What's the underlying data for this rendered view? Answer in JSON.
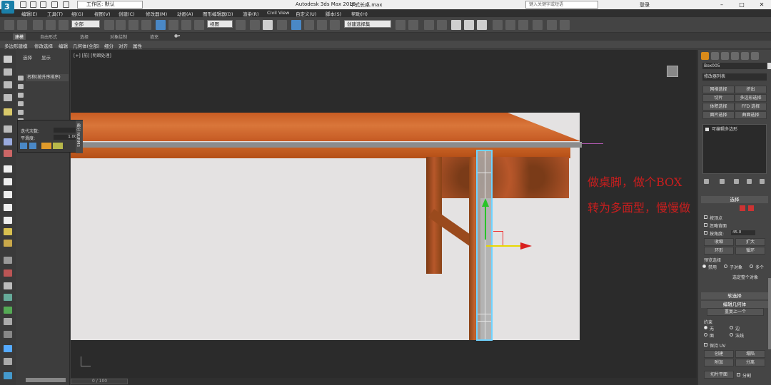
{
  "window": {
    "title": "Autodesk 3ds Max 2016",
    "file_name": "中式长桌.max",
    "workspace_label": "工作区: 默认",
    "search_placeholder": "键入关键字或短语",
    "sign_in": "登录",
    "minimize": "–",
    "maximize": "□",
    "close": "✕"
  },
  "menu": [
    "编辑(E)",
    "工具(T)",
    "组(G)",
    "视图(V)",
    "创建(C)",
    "修改器(M)",
    "动画(A)",
    "图形编辑器(D)",
    "渲染(R)",
    "Civil View",
    "自定义(U)",
    "脚本(S)",
    "帮助(H)"
  ],
  "toolbar": {
    "filter": "全部",
    "coord": "视图",
    "selection_set": "创建选择集"
  },
  "ribbon": {
    "tabs": [
      "建模",
      "自由形式",
      "选择",
      "对象绘制",
      "填充"
    ],
    "active_tab": "建模",
    "sub_items": [
      "多边形建模",
      "修改选择",
      "编辑",
      "几何体(全部)",
      "细分",
      "对齐",
      "属性"
    ]
  },
  "explorer": {
    "tabs": [
      "选择",
      "显示"
    ],
    "header": "名称(按升序排序)"
  },
  "floatpanel": {
    "iter_label": "迭代次数:",
    "iter_value": "1",
    "smooth_label": "平滑度:",
    "smooth_value": "1.000",
    "side_tab": "细分 NURMS"
  },
  "viewport": {
    "label": "[+] [前] [明暗处理]",
    "annotation_line1": "做桌脚，做个BOX",
    "annotation_line2": "转为多面型，慢慢做"
  },
  "command_panel": {
    "object_name": "Box005",
    "modifier_list": "修改器列表",
    "buttons": [
      "网格选择",
      "挤出",
      "切片",
      "多边形选择",
      "体积选择",
      "FFD 选择",
      "面片选择",
      "曲面选择"
    ],
    "stack_item": "可编辑多边形",
    "rollout_select": "选择",
    "by_vertex": "按顶点",
    "ignore_backfacing": "忽略背面",
    "by_angle": "按角度:",
    "angle_value": "45.0",
    "shrink": "收缩",
    "grow": "扩大",
    "ring": "环形",
    "loop": "循环",
    "preview_label": "预览选择",
    "preview_off": "禁用",
    "preview_subobj": "子对象",
    "preview_multi": "多个",
    "selection_info": "选定整个对象",
    "rollout_soft": "软选择",
    "rollout_edit_geom": "编辑几何体",
    "repeat_last": "重复上一个",
    "constraints": "约束",
    "c_none": "无",
    "c_edge": "边",
    "c_face": "面",
    "c_normal": "法线",
    "preserve_uv": "保持 UV",
    "create": "创建",
    "collapse": "塌陷",
    "attach": "附加",
    "detach": "分离",
    "slice_plane": "切片平面",
    "split": "分割"
  },
  "status": {
    "frame": "0 / 100"
  },
  "colors": {
    "accent_orange": "#d98a1a",
    "annotation_red": "#c81e1e",
    "selection_cyan": "#6fd3ff"
  }
}
